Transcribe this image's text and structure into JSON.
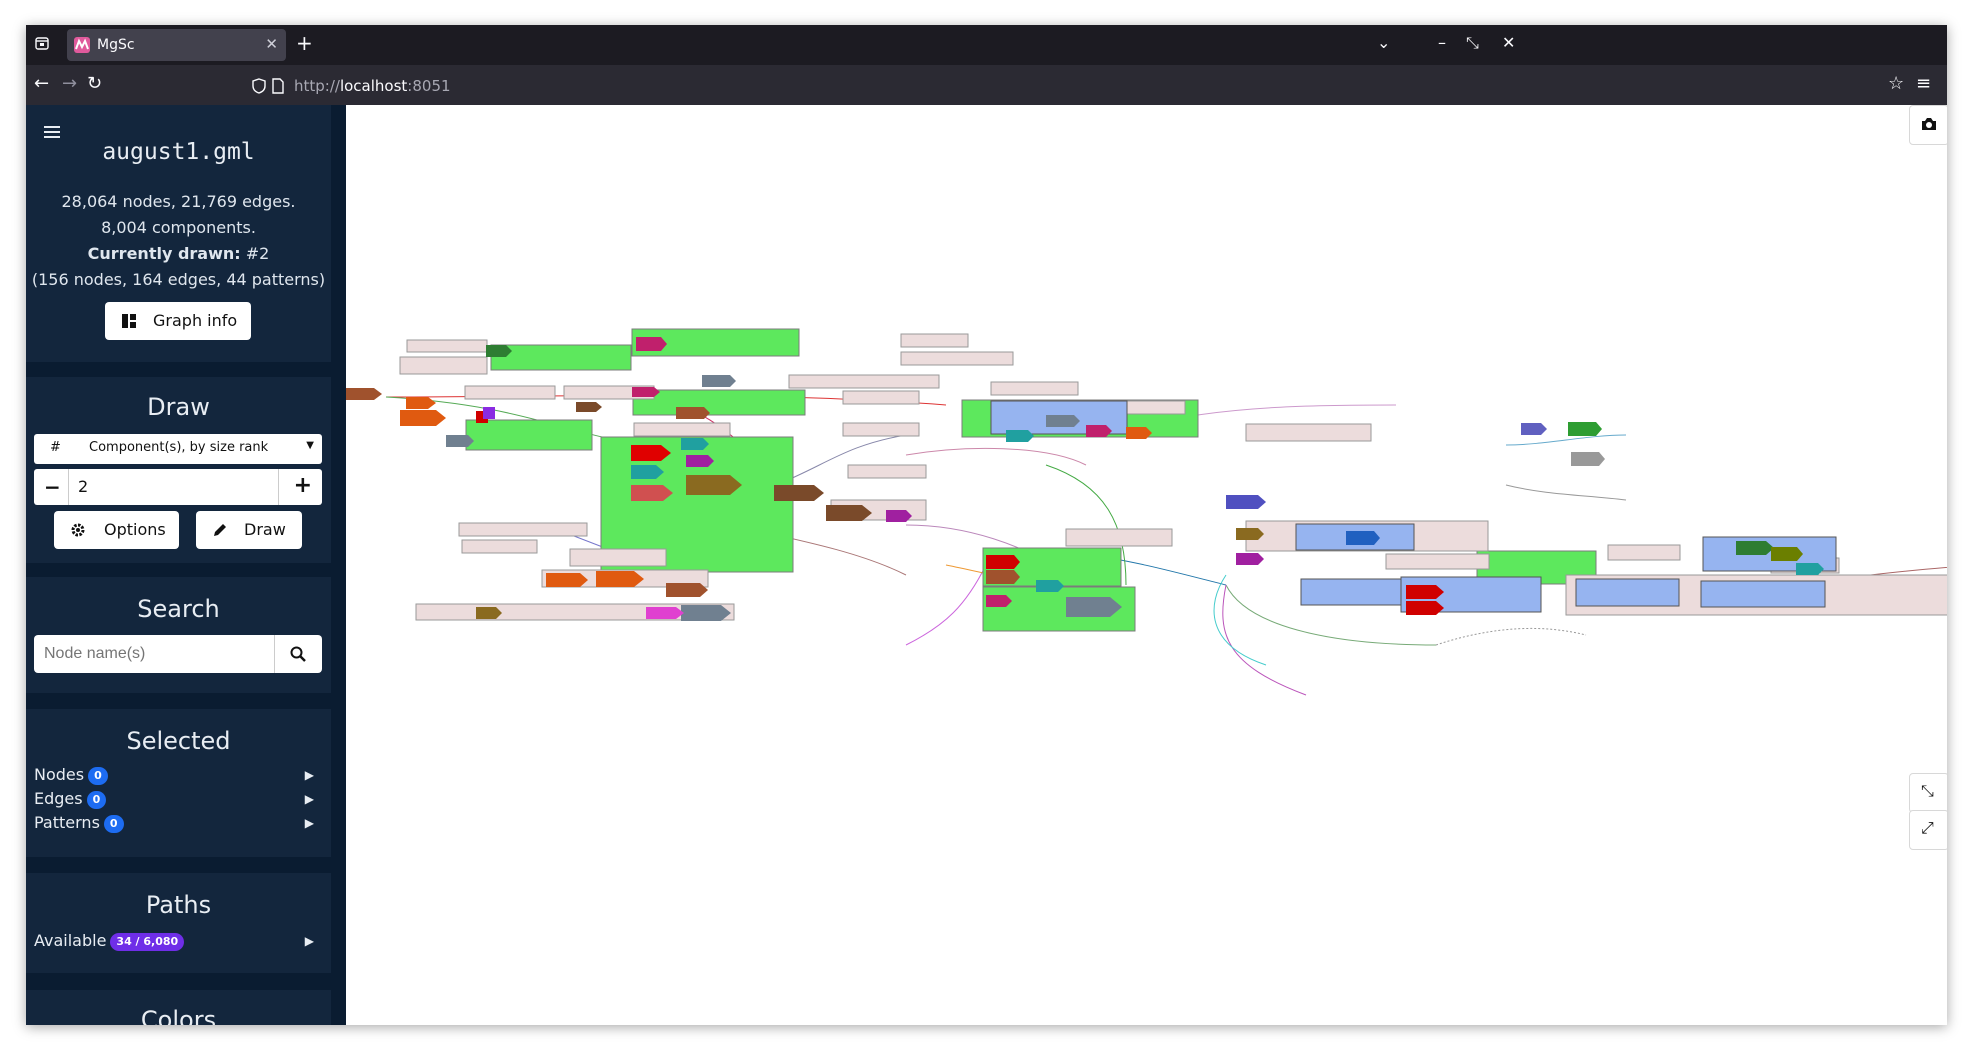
{
  "browser": {
    "tab_title": "MgSc",
    "url_scheme": "http://",
    "url_host": "localhost",
    "url_port": ":8051"
  },
  "sidebar": {
    "file": {
      "filename": "august1.gml",
      "nodes_edges": "28,064 nodes, 21,769 edges.",
      "components": "8,004 components.",
      "currently_label": "Currently drawn:",
      "currently_value": " #2",
      "current_stats": "(156 nodes, 164 edges, 44 patterns)",
      "graph_info_label": "Graph info"
    },
    "draw": {
      "title": "Draw",
      "prefix": "#",
      "mode": "Component(s), by size rank",
      "value": "2",
      "minus": "−",
      "plus": "+",
      "options_label": "Options",
      "draw_label": "Draw"
    },
    "search": {
      "title": "Search",
      "placeholder": "Node name(s)"
    },
    "selected": {
      "title": "Selected",
      "nodes_label": "Nodes",
      "nodes_count": "0",
      "edges_label": "Edges",
      "edges_count": "0",
      "patterns_label": "Patterns",
      "patterns_count": "0"
    },
    "paths": {
      "title": "Paths",
      "available_label": "Available",
      "available_count": "34 / 6,080"
    },
    "colors": {
      "title": "Colors"
    }
  },
  "colors": {
    "pattern_green": "#5de85d",
    "pattern_blue": "#96b4f0",
    "pattern_pink": "#ecdcdc",
    "sidebar_bg": "#0a1c31",
    "card_bg": "#13263d",
    "badge_blue": "#1d6cf2",
    "badge_purple": "#6f2ee8"
  }
}
